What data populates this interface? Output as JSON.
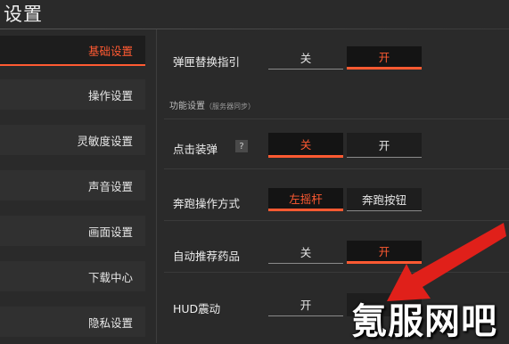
{
  "window": {
    "title": "设置"
  },
  "sidebar": {
    "items": [
      {
        "label": "基础设置",
        "active": true
      },
      {
        "label": "操作设置",
        "active": false
      },
      {
        "label": "灵敏度设置",
        "active": false
      },
      {
        "label": "声音设置",
        "active": false
      },
      {
        "label": "画面设置",
        "active": false
      },
      {
        "label": "下载中心",
        "active": false
      },
      {
        "label": "隐私设置",
        "active": false
      }
    ]
  },
  "settings": {
    "clip_swap": {
      "label": "弹匣替换指引",
      "options": [
        "关",
        "开"
      ],
      "selected": "开"
    },
    "section": {
      "title": "功能设置",
      "note": "（服务器同步）"
    },
    "tap_reload": {
      "label": "点击装弹",
      "help": "?",
      "options": [
        "关",
        "开"
      ],
      "selected": "关"
    },
    "sprint_mode": {
      "label": "奔跑操作方式",
      "options": [
        "左摇杆",
        "奔跑按钮"
      ],
      "selected": "左摇杆"
    },
    "auto_medkit": {
      "label": "自动推荐药品",
      "options": [
        "关",
        "开"
      ],
      "selected": "开"
    },
    "hud_shake": {
      "label": "HUD震动",
      "options": [
        "开"
      ]
    }
  },
  "overlay": {
    "watermark": "氪服网吧",
    "arrow_color": "#e0201a"
  },
  "colors": {
    "accent": "#ff5a32",
    "background": "#2a2a2a"
  }
}
